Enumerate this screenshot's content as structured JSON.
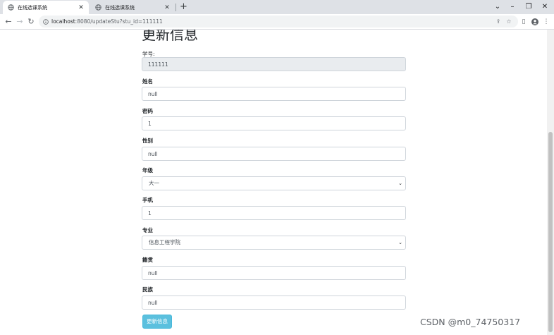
{
  "browser": {
    "tabs": [
      {
        "title": "在线选课系统",
        "active": true
      },
      {
        "title": "在线选课系统",
        "active": false
      }
    ],
    "address": {
      "host": "localhost",
      "rest": ":8080/updateStu?stu_id=111111"
    }
  },
  "page": {
    "heading": "更新信息",
    "fields": {
      "stu_id": {
        "label": "学号:",
        "value": "111111"
      },
      "name": {
        "label": "姓名",
        "value": "null"
      },
      "password": {
        "label": "密码",
        "value": "1"
      },
      "gender": {
        "label": "性别",
        "value": "null"
      },
      "grade": {
        "label": "年级",
        "value": "大一"
      },
      "phone": {
        "label": "手机",
        "value": "1"
      },
      "major": {
        "label": "专业",
        "value": "信息工程学院"
      },
      "native_place": {
        "label": "籍贯",
        "value": "null"
      },
      "ethnicity": {
        "label": "民族",
        "value": "null"
      }
    },
    "submit_label": "更新信息"
  },
  "watermark": "CSDN @m0_74750317",
  "colors": {
    "button_bg": "#5bc0de",
    "tabstrip_bg": "#dee1e6",
    "readonly_bg": "#e9ecef"
  }
}
